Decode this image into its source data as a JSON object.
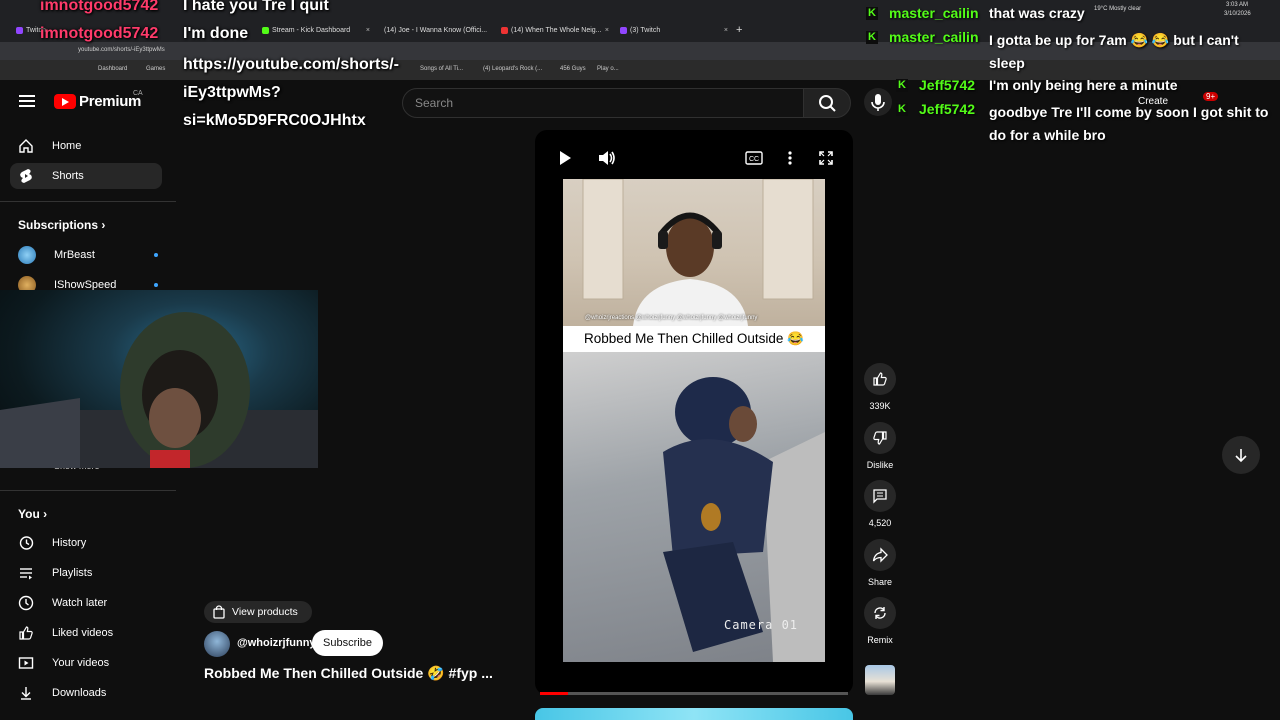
{
  "browser": {
    "tabs": [
      {
        "label": "Twitch"
      },
      {
        "label": "Stream - Kick Dashboard"
      },
      {
        "label": "(14) Joe - I Wanna Know (Offici..."
      },
      {
        "label": "(14) When The Whole Neig..."
      },
      {
        "label": "(3) Twitch"
      }
    ],
    "url": "youtube.com/shorts/-iEy3ttpwMs",
    "bookmarks": [
      "Dashboard",
      "Games",
      "Songs of All Ti...",
      "(4) Leopard's Rock (...",
      "456 Guys",
      "Play o..."
    ],
    "tray": {
      "weather": "19°C Mostly clear",
      "time": "3:03 AM",
      "date": "3/10/2026"
    },
    "new_tab": "+",
    "close_x": "×"
  },
  "youtube": {
    "logo_text": "Premium",
    "logo_region": "CA",
    "search_placeholder": "Search",
    "create_label": "Create",
    "notif_badge": "9+"
  },
  "sidebar": {
    "main": [
      {
        "label": "Home",
        "icon": "home-icon",
        "active": false
      },
      {
        "label": "Shorts",
        "icon": "shorts-icon",
        "active": true
      }
    ],
    "subscriptions_title": "Subscriptions",
    "subscriptions": [
      {
        "label": "MrBeast",
        "color": "#4aa3d8"
      },
      {
        "label": "IShowSpeed",
        "color": "#c9902b"
      }
    ],
    "show_more": "Show more",
    "you_title": "You",
    "you_items": [
      {
        "label": "History",
        "icon": "history-icon"
      },
      {
        "label": "Playlists",
        "icon": "playlists-icon"
      },
      {
        "label": "Watch later",
        "icon": "watch-later-icon"
      },
      {
        "label": "Liked videos",
        "icon": "liked-icon"
      },
      {
        "label": "Your videos",
        "icon": "your-videos-icon"
      },
      {
        "label": "Downloads",
        "icon": "downloads-icon"
      }
    ]
  },
  "overlay": {
    "left_lines": [
      {
        "user": "imnotgood5742",
        "text": "I hate you Tre I quit"
      },
      {
        "user": "imnotgood5742",
        "text": "I'm done"
      }
    ],
    "link_lines": [
      "https://youtube.com/shorts/-",
      "iEy3ttpwMs?",
      "si=kMo5D9FRC0OJHhtx"
    ],
    "chat": [
      {
        "user": "master_cailin",
        "text": "that was crazy"
      },
      {
        "user": "master_cailin",
        "text": "I gotta be up for 7am 😂 😂 but I can't sleep"
      },
      {
        "user": "Jeff5742",
        "text": "I'm only being here a minute"
      },
      {
        "user": "Jeff5742",
        "text": "goodbye Tre I'll come by soon I got shit to do for a while bro"
      }
    ],
    "badge_letter": "K"
  },
  "short": {
    "video_caption": "Robbed Me Then Chilled Outside 😂",
    "watermark": "@whoizrjreactions  @whoizrjfunny  @whoizrjfunny  @whoizrjfunny",
    "camera_label": "Camera 01",
    "progress_fraction": 0.09,
    "channel": "@whoizrjfunny",
    "subscribe_label": "Subscribe",
    "view_products_label": "View products",
    "title": "Robbed Me Then Chilled Outside 🤣 #fyp ...",
    "actions": [
      {
        "icon": "like-icon",
        "label": "339K"
      },
      {
        "icon": "dislike-icon",
        "label": "Dislike"
      },
      {
        "icon": "comment-icon",
        "label": "4,520"
      },
      {
        "icon": "share-icon",
        "label": "Share"
      },
      {
        "icon": "remix-icon",
        "label": "Remix"
      }
    ]
  }
}
